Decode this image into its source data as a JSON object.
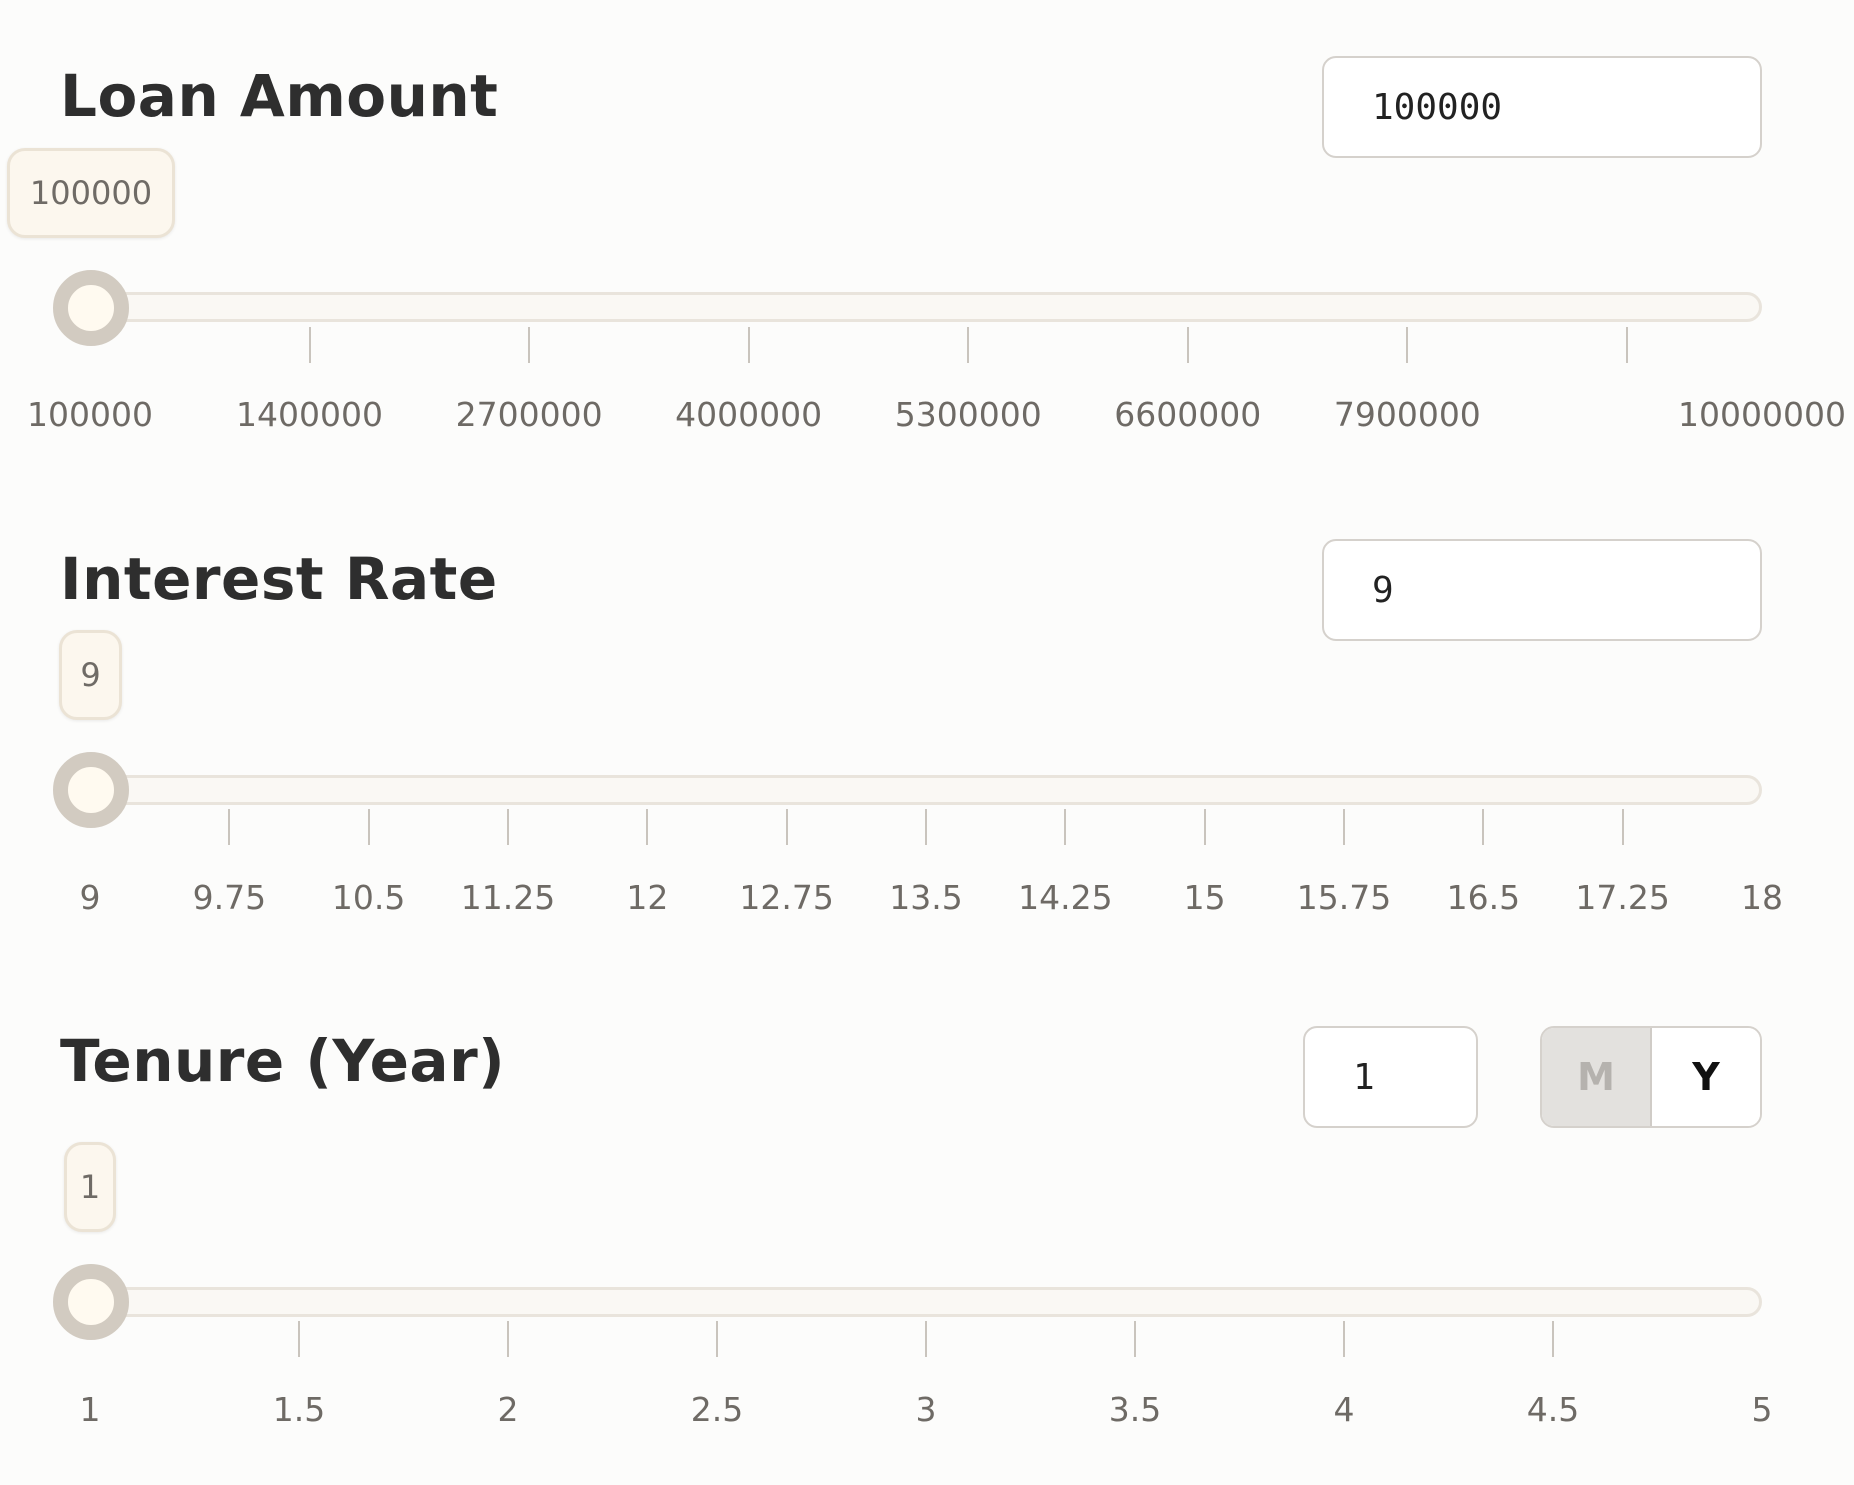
{
  "loan_amount": {
    "title": "Loan Amount",
    "input_value": "100000",
    "bubble_value": "100000",
    "slider": {
      "min": 100000,
      "max": 10000000,
      "value": 100000
    },
    "ticks": [
      "100000",
      "1400000",
      "2700000",
      "4000000",
      "5300000",
      "6600000",
      "7900000",
      "10000000"
    ],
    "tick_values": [
      100000,
      1400000,
      2700000,
      4000000,
      5300000,
      6600000,
      7900000,
      9200000,
      10000000
    ]
  },
  "interest_rate": {
    "title": "Interest Rate",
    "input_value": "9",
    "bubble_value": "9",
    "slider": {
      "min": 9,
      "max": 18,
      "value": 9
    },
    "ticks": [
      "9",
      "9.75",
      "10.5",
      "11.25",
      "12",
      "12.75",
      "13.5",
      "14.25",
      "15",
      "15.75",
      "16.5",
      "17.25",
      "18"
    ]
  },
  "tenure": {
    "title": "Tenure (Year)",
    "input_value": "1",
    "bubble_value": "1",
    "slider": {
      "min": 1,
      "max": 5,
      "value": 1
    },
    "ticks": [
      "1",
      "1.5",
      "2",
      "2.5",
      "3",
      "3.5",
      "4",
      "4.5",
      "5"
    ],
    "unit_toggle": {
      "month_label": "M",
      "year_label": "Y",
      "selected": "Y"
    }
  }
}
